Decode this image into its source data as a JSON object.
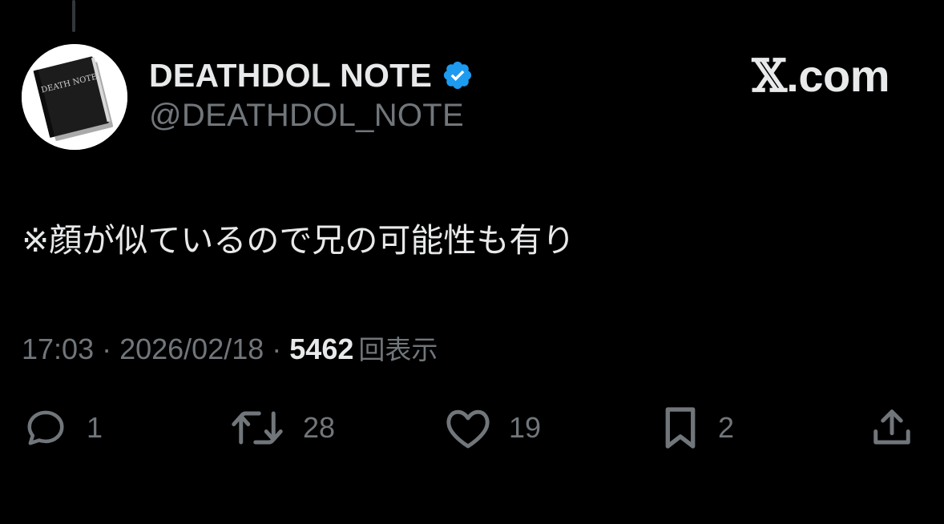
{
  "author": {
    "display_name": "DEATHDOL NOTE",
    "handle": "@DEATHDOL_NOTE",
    "verified": true,
    "avatar_book_text": "DEATH NOTE"
  },
  "brand": {
    "x_glyph": "𝕏",
    "suffix": ".com"
  },
  "tweet": {
    "text": "※顔が似ているので兄の可能性も有り",
    "time": "17:03",
    "date": "2026/02/18",
    "separator": "·",
    "views_count": "5462",
    "views_label": "回表示"
  },
  "actions": {
    "replies": "1",
    "retweets": "28",
    "likes": "19",
    "bookmarks": "2"
  },
  "colors": {
    "background": "#000000",
    "primary_text": "#e7e9ea",
    "secondary_text": "#71767b",
    "verified_blue": "#1d9bf0"
  },
  "icons": [
    "verified-badge-icon",
    "reply-icon",
    "retweet-icon",
    "like-icon",
    "bookmark-icon",
    "share-icon"
  ]
}
